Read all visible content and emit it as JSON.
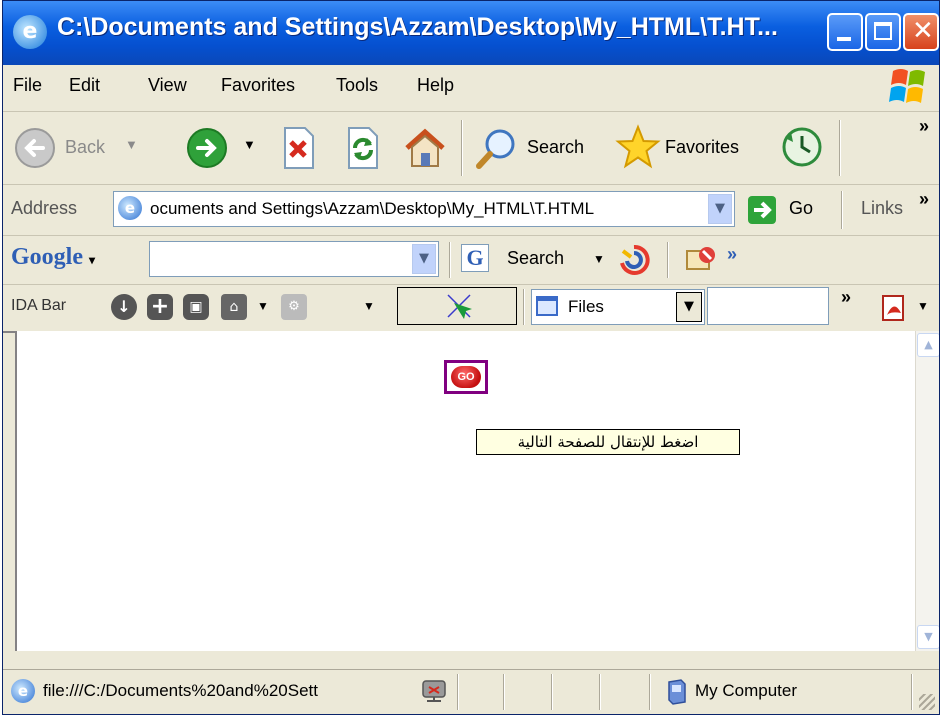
{
  "window": {
    "title": "C:\\Documents and Settings\\Azzam\\Desktop\\My_HTML\\T.HT..."
  },
  "menu": {
    "items": [
      "File",
      "Edit",
      "View",
      "Favorites",
      "Tools",
      "Help"
    ]
  },
  "toolbar": {
    "back_label": "Back",
    "search_label": "Search",
    "favorites_label": "Favorites",
    "overflow": "»"
  },
  "address": {
    "label": "Address",
    "value": "ocuments and Settings\\Azzam\\Desktop\\My_HTML\\T.HTML",
    "go_label": "Go",
    "links_label": "Links",
    "overflow": "»"
  },
  "google": {
    "logo": "Google",
    "search_label": "Search",
    "overflow": "»"
  },
  "ida": {
    "label": "IDA Bar",
    "files_label": "Files",
    "overflow": "»"
  },
  "content": {
    "go_button_label": "GO",
    "tooltip": "اضغط للإنتقال للصفحة التالية"
  },
  "status": {
    "url": "file:///C:/Documents%20and%20Sett",
    "zone": "My Computer"
  },
  "colors": {
    "titlebar": "#0a5fe0",
    "chrome": "#ece9d8",
    "go_button": "#d42020",
    "go_frame": "#800080",
    "tooltip_bg": "#ffffe1"
  }
}
